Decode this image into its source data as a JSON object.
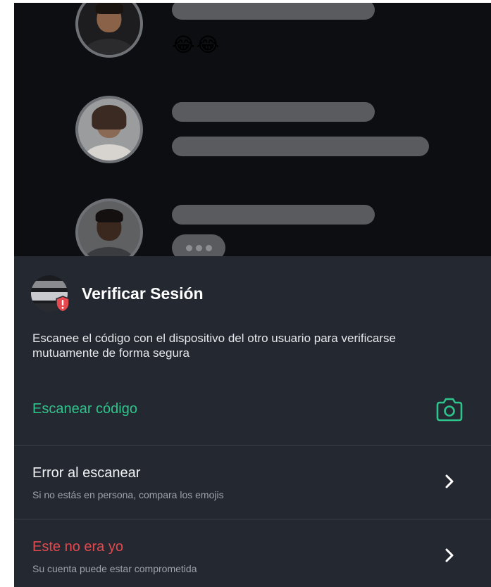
{
  "background_chat": {
    "emoji_message": "😂😂"
  },
  "sheet": {
    "title": "Verificar Sesión",
    "description": "Escanee el código con el dispositivo del otro usuario para verificarse mutuamente de forma segura",
    "scan_label": "Escanear código",
    "options": [
      {
        "title": "Error al escanear",
        "subtitle": "Si no estás en persona, compara los emojis"
      },
      {
        "title": "Este no era yo",
        "subtitle": "Su cuenta puede estar comprometida"
      }
    ]
  },
  "colors": {
    "accent_green": "#2ec48b",
    "danger_red": "#e5484d",
    "sheet_bg": "#232831",
    "overlay_bg": "#0d0e12"
  },
  "icons": {
    "scan": "camera-icon",
    "option_arrow": "chevron-right-icon",
    "warning_badge": "shield-alert-icon"
  }
}
